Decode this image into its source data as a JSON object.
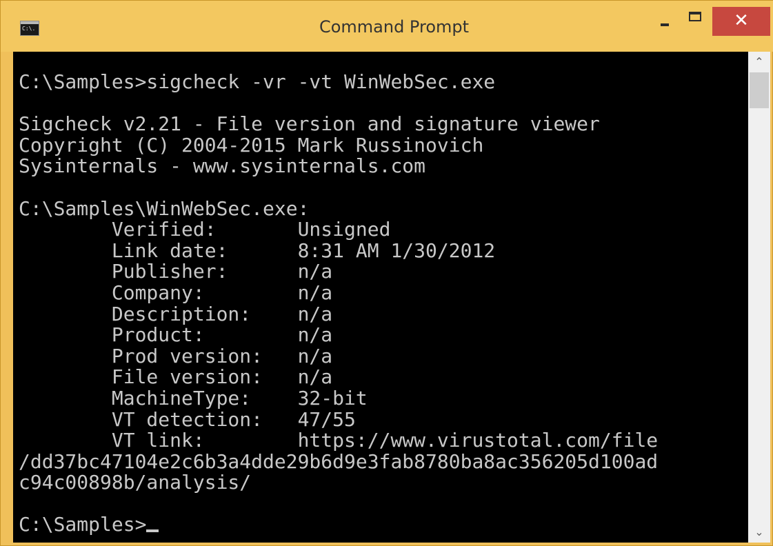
{
  "window": {
    "title": "Command Prompt",
    "icon": "cmd-icon",
    "icon_text": "C:\\.",
    "close_glyph": "✕",
    "accent_color": "#f3c860",
    "close_color": "#c7483f"
  },
  "scrollbar": {
    "up_glyph": "⌃",
    "down_glyph": "⌄"
  },
  "console": {
    "lines": [
      "C:\\Samples>sigcheck -vr -vt WinWebSec.exe",
      "",
      "Sigcheck v2.21 - File version and signature viewer",
      "Copyright (C) 2004-2015 Mark Russinovich",
      "Sysinternals - www.sysinternals.com",
      "",
      "C:\\Samples\\WinWebSec.exe:",
      "        Verified:       Unsigned",
      "        Link date:      8:31 AM 1/30/2012",
      "        Publisher:      n/a",
      "        Company:        n/a",
      "        Description:    n/a",
      "        Product:        n/a",
      "        Prod version:   n/a",
      "        File version:   n/a",
      "        MachineType:    32-bit",
      "        VT detection:   47/55",
      "        VT link:        https://www.virustotal.com/file",
      "/dd37bc47104e2c6b3a4dde29b6d9e3fab8780ba8ac356205d100ad",
      "c94c00898b/analysis/",
      "",
      "C:\\Samples>"
    ]
  }
}
